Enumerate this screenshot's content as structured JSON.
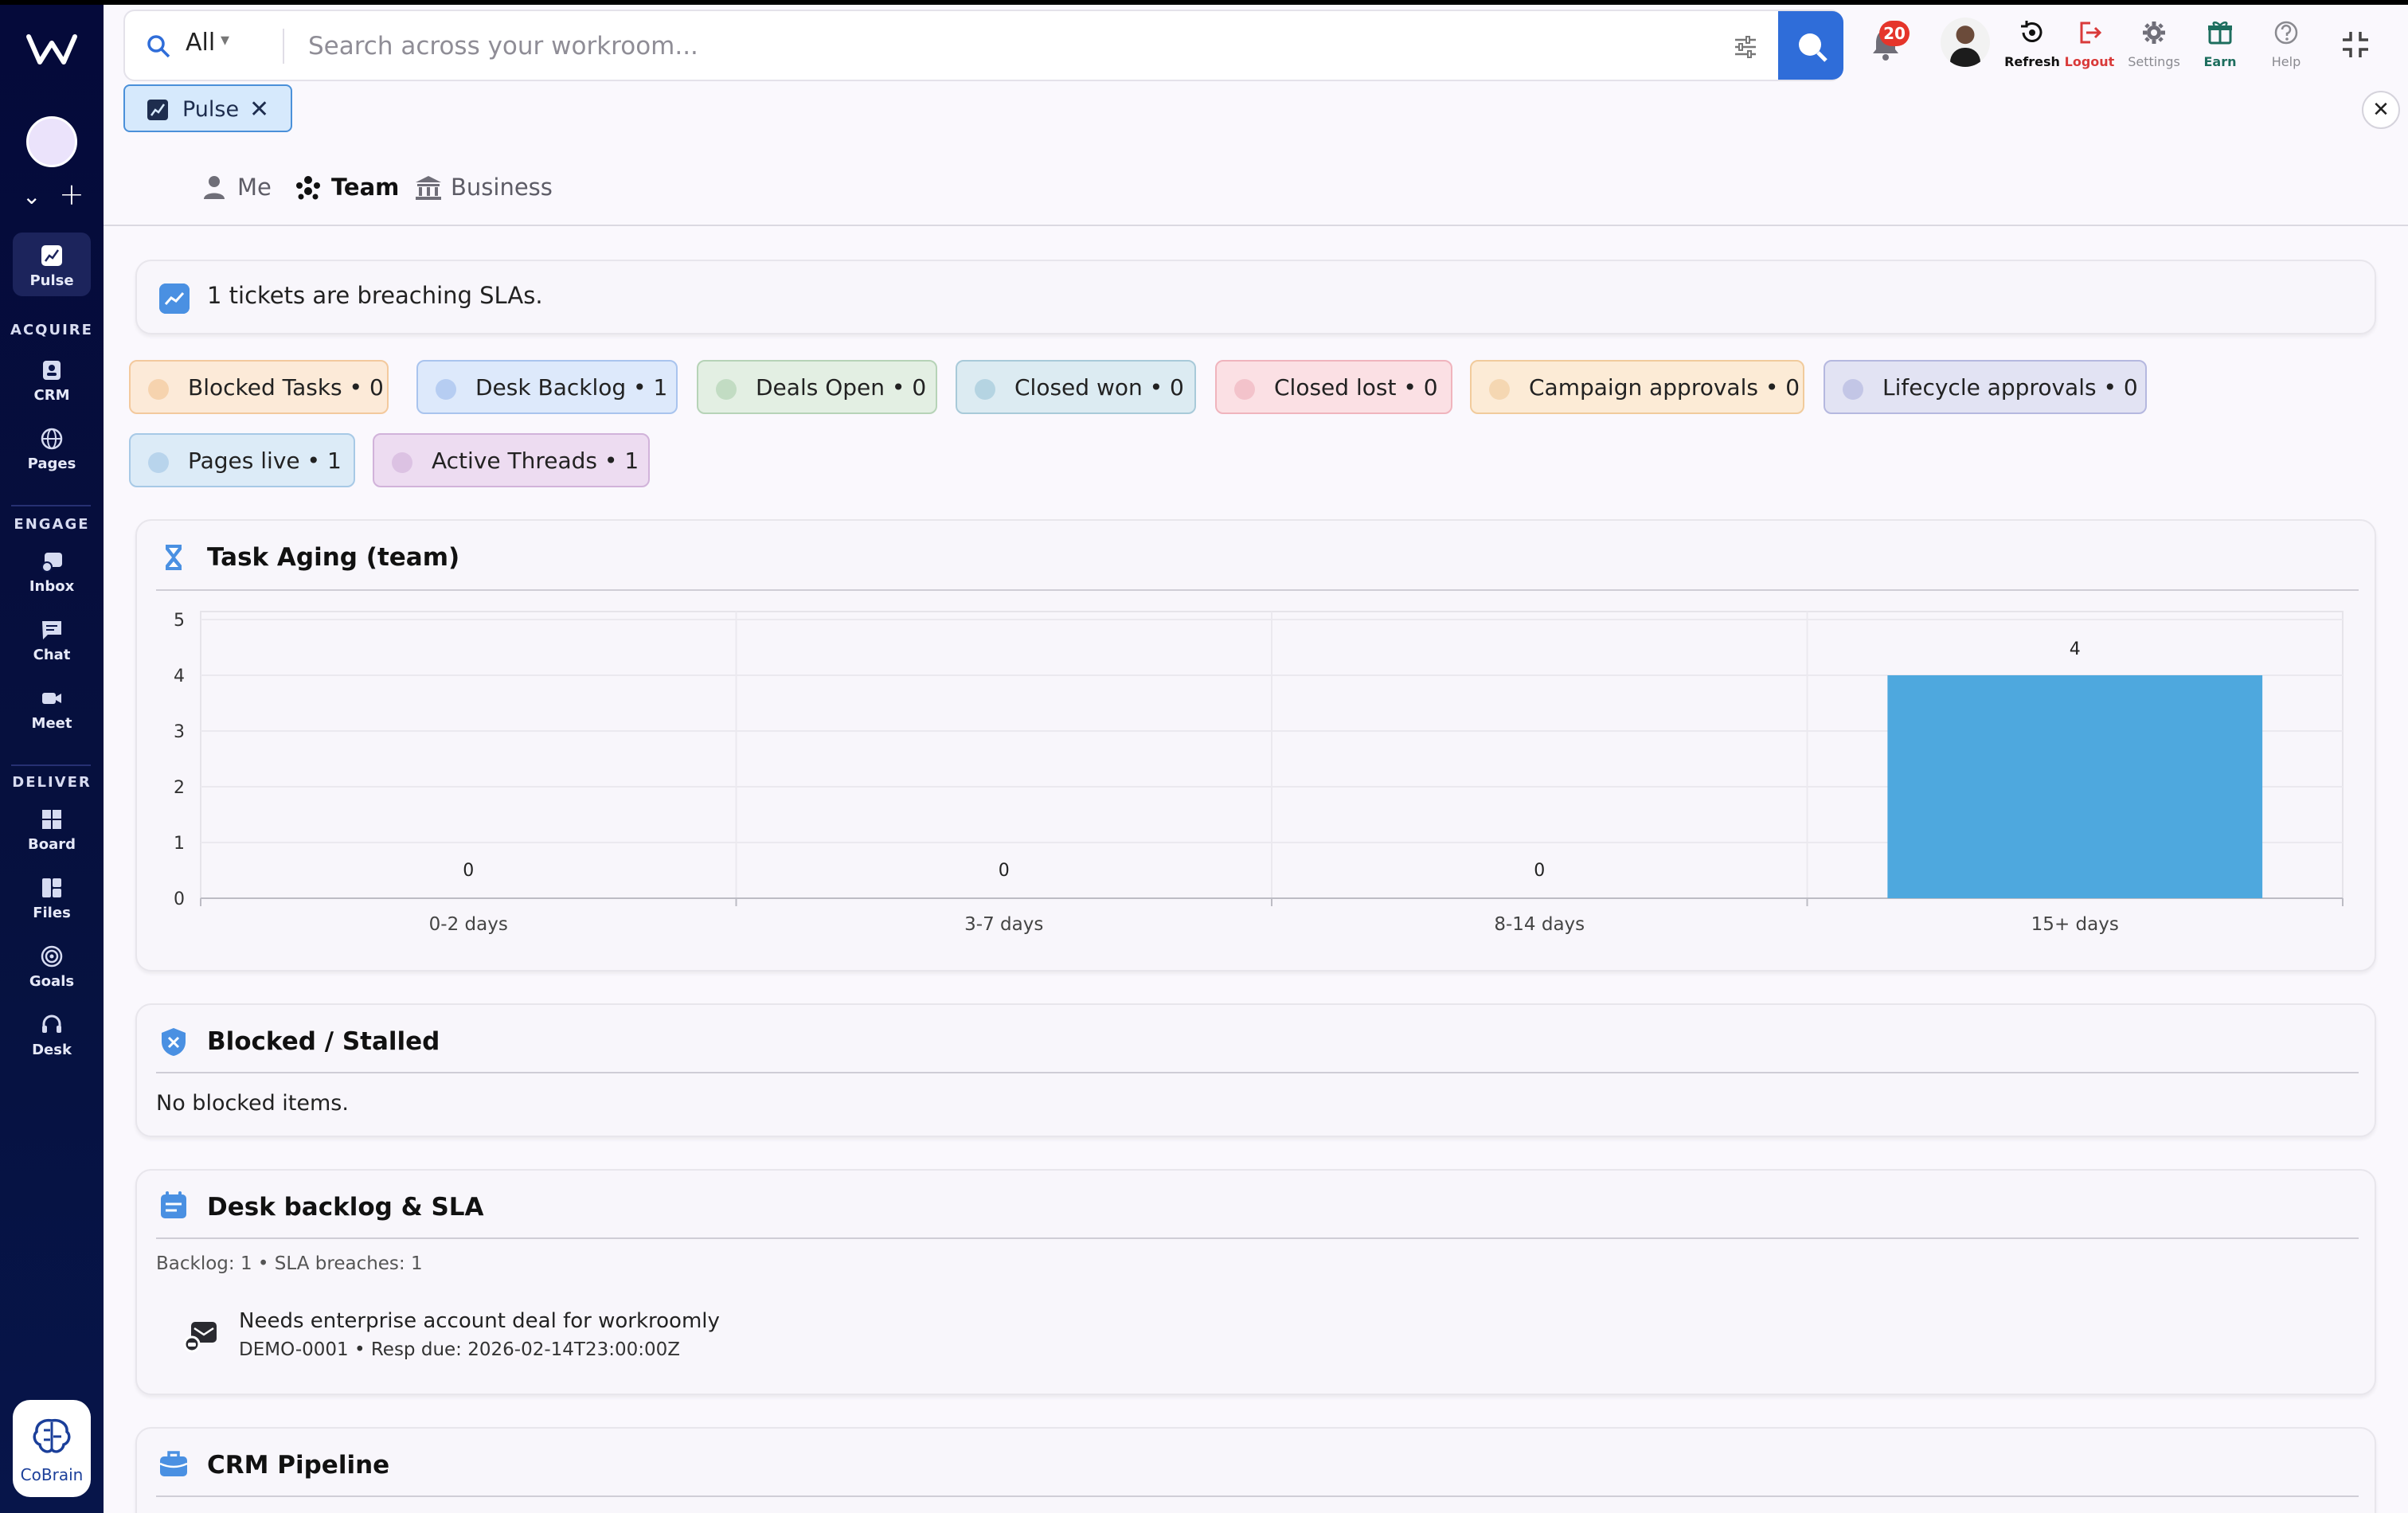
{
  "sidebar": {
    "sections": [
      {
        "label": "ACQUIRE"
      },
      {
        "label": "ENGAGE"
      },
      {
        "label": "DELIVER"
      }
    ],
    "items": [
      {
        "label": "Pulse",
        "icon": "pulse-chart-icon",
        "active": true
      },
      {
        "label": "CRM",
        "icon": "crm-icon"
      },
      {
        "label": "Pages",
        "icon": "globe-icon"
      },
      {
        "label": "Inbox",
        "icon": "inbox-icon"
      },
      {
        "label": "Chat",
        "icon": "chat-icon"
      },
      {
        "label": "Meet",
        "icon": "video-icon"
      },
      {
        "label": "Board",
        "icon": "board-icon"
      },
      {
        "label": "Files",
        "icon": "files-icon"
      },
      {
        "label": "Goals",
        "icon": "target-icon"
      },
      {
        "label": "Desk",
        "icon": "headset-icon"
      }
    ],
    "cobrain_label": "CoBrain"
  },
  "search": {
    "scope": "All",
    "placeholder": "Search across your workroom..."
  },
  "header": {
    "notifications_count": "20",
    "tools": [
      {
        "label": "Refresh",
        "icon": "refresh-icon",
        "color": "#111111"
      },
      {
        "label": "Logout",
        "icon": "logout-icon",
        "color": "#d93a3a"
      },
      {
        "label": "Settings",
        "icon": "gear-icon",
        "color": "#8a8a90"
      },
      {
        "label": "Earn",
        "icon": "gift-icon",
        "color": "#1d6e5e"
      },
      {
        "label": "Help",
        "icon": "help-icon",
        "color": "#8a8a90"
      }
    ]
  },
  "open_tab": {
    "label": "Pulse",
    "icon": "pulse-chart-icon"
  },
  "scope_tabs": [
    {
      "label": "Me",
      "icon": "person-icon"
    },
    {
      "label": "Team",
      "icon": "team-icon",
      "active": true
    },
    {
      "label": "Business",
      "icon": "bank-icon"
    }
  ],
  "sla_alert": "1 tickets are breaching SLAs.",
  "chips": [
    {
      "label": "Blocked Tasks • 0",
      "bg": "#fcead8",
      "border": "#f3c99d",
      "dot": "#f6d3ae"
    },
    {
      "label": "Desk Backlog • 1",
      "bg": "#dde9fb",
      "border": "#a9c4ee",
      "dot": "#b6cdf2"
    },
    {
      "label": "Deals Open • 0",
      "bg": "#e3efe3",
      "border": "#b6d3b7",
      "dot": "#c2dcc3"
    },
    {
      "label": "Closed won • 0",
      "bg": "#dcebf2",
      "border": "#a8cad9",
      "dot": "#b5d4e2"
    },
    {
      "label": "Closed lost • 0",
      "bg": "#fbe0e4",
      "border": "#f0b4bd",
      "dot": "#f3c3cb"
    },
    {
      "label": "Campaign approvals • 0",
      "bg": "#fcebd6",
      "border": "#f1cb9c",
      "dot": "#f5d7b2"
    },
    {
      "label": "Lifecycle approvals • 0",
      "bg": "#e2e3f3",
      "border": "#b5b8df",
      "dot": "#c3c6e6"
    },
    {
      "label": "Pages live • 1",
      "bg": "#dcebf7",
      "border": "#a7c9e6",
      "dot": "#b8d4ec"
    },
    {
      "label": "Active Threads • 1",
      "bg": "#eddcf1",
      "border": "#d1b3da",
      "dot": "#dcc2e3"
    }
  ],
  "task_aging": {
    "title": "Task Aging (team)"
  },
  "chart_data": {
    "type": "bar",
    "categories": [
      "0-2 days",
      "3-7 days",
      "8-14 days",
      "15+ days"
    ],
    "values": [
      0,
      0,
      0,
      4
    ],
    "data_labels": [
      "0",
      "0",
      "0",
      "4"
    ],
    "yticks": [
      "0",
      "1",
      "2",
      "3",
      "4",
      "5"
    ],
    "ylim": [
      0,
      5
    ],
    "grid": true,
    "bar_color": "#4ea8de"
  },
  "blocked": {
    "title": "Blocked / Stalled",
    "empty_text": "No blocked items."
  },
  "desk": {
    "title": "Desk backlog & SLA",
    "meta": "Backlog: 1 • SLA breaches: 1",
    "items": [
      {
        "title": "Needs enterprise account deal for workroomly",
        "sub": "DEMO-0001 • Resp due: 2026-02-14T23:00:00Z",
        "icon": "inbox-ticket-icon"
      }
    ]
  },
  "crm": {
    "title": "CRM Pipeline"
  }
}
